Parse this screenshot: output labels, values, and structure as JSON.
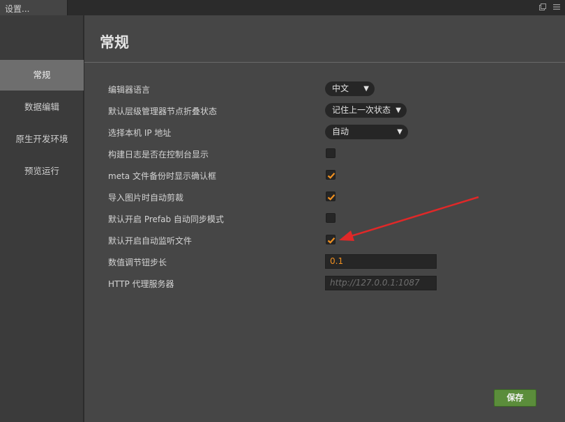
{
  "window": {
    "tab_title": "设置..."
  },
  "sidebar": {
    "items": [
      {
        "label": "常规",
        "active": true
      },
      {
        "label": "数据编辑"
      },
      {
        "label": "原生开发环境"
      },
      {
        "label": "预览运行"
      }
    ]
  },
  "main": {
    "title": "常规",
    "settings": [
      {
        "label": "编辑器语言",
        "type": "select",
        "value": "中文"
      },
      {
        "label": "默认层级管理器节点折叠状态",
        "type": "select",
        "value": "记住上一次状态"
      },
      {
        "label": "选择本机 IP 地址",
        "type": "select",
        "value": "自动"
      },
      {
        "label": "构建日志是否在控制台显示",
        "type": "checkbox",
        "checked": false
      },
      {
        "label": "meta 文件备份时显示确认框",
        "type": "checkbox",
        "checked": true
      },
      {
        "label": "导入图片时自动剪裁",
        "type": "checkbox",
        "checked": true
      },
      {
        "label": "默认开启 Prefab 自动同步模式",
        "type": "checkbox",
        "checked": false
      },
      {
        "label": "默认开启自动监听文件",
        "type": "checkbox",
        "checked": true
      },
      {
        "label": "数值调节钮步长",
        "type": "input",
        "value": "0.1"
      },
      {
        "label": "HTTP 代理服务器",
        "type": "input",
        "value": "",
        "placeholder": "http://127.0.0.1:1087"
      }
    ],
    "save_label": "保存"
  },
  "colors": {
    "accent_orange": "#f09020",
    "save_green": "#5b8d3b",
    "annotation_red": "#e02828"
  },
  "annotation": {
    "type": "arrow",
    "color": "red"
  }
}
